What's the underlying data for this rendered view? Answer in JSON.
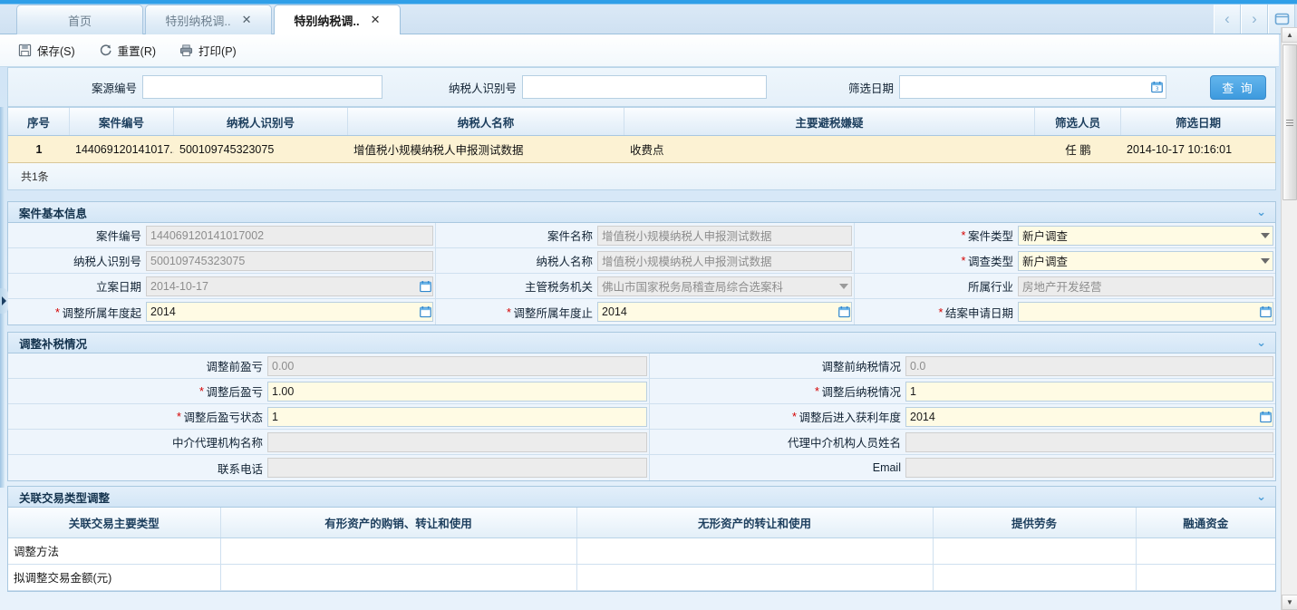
{
  "window": {
    "nav_prev": "‹",
    "nav_next": "›",
    "restore": "restore-window"
  },
  "tabs": [
    {
      "label": "首页",
      "active": false,
      "closable": false
    },
    {
      "label": "特别纳税调..",
      "active": false,
      "closable": true
    },
    {
      "label": "特别纳税调..",
      "active": true,
      "closable": true
    }
  ],
  "toolbar": {
    "save_label": "保存(S)",
    "reset_label": "重置(R)",
    "print_label": "打印(P)"
  },
  "search": {
    "case_source_no_label": "案源编号",
    "case_source_no_value": "",
    "taxpayer_id_label": "纳税人识别号",
    "taxpayer_id_value": "",
    "filter_date_label": "筛选日期",
    "filter_date_value": "",
    "query_button": "查 询"
  },
  "result_grid": {
    "columns": [
      "序号",
      "案件编号",
      "纳税人识别号",
      "纳税人名称",
      "主要避税嫌疑",
      "筛选人员",
      "筛选日期"
    ],
    "rows": [
      {
        "seq": "1",
        "case_no": "144069120141017...",
        "taxpayer_id": "500109745323075",
        "taxpayer_name": "增值税小规模纳税人申报测试数据",
        "tax_avoidance_suspicion": "收费点",
        "filter_person": "任  鹏",
        "filter_date": "2014-10-17 10:16:01"
      }
    ],
    "footer": "共1条"
  },
  "section_basic": {
    "title": "案件基本信息",
    "collapse_icon": "⌄",
    "fields": {
      "case_no_label": "案件编号",
      "case_no_value": "144069120141017002",
      "case_name_label": "案件名称",
      "case_name_value": "增值税小规模纳税人申报测试数据",
      "case_type_label": "案件类型",
      "case_type_value": "新户调查",
      "taxpayer_id_label": "纳税人识别号",
      "taxpayer_id_value": "500109745323075",
      "taxpayer_name_label": "纳税人名称",
      "taxpayer_name_value": "增值税小规模纳税人申报测试数据",
      "survey_type_label": "调查类型",
      "survey_type_value": "新户调查",
      "filing_date_label": "立案日期",
      "filing_date_value": "2014-10-17",
      "tax_authority_label": "主管税务机关",
      "tax_authority_value": "佛山市国家税务局稽查局综合选案科",
      "industry_label": "所属行业",
      "industry_value": "房地产开发经营",
      "adjust_year_from_label": "调整所属年度起",
      "adjust_year_from_value": "2014",
      "adjust_year_to_label": "调整所属年度止",
      "adjust_year_to_value": "2014",
      "close_apply_date_label": "结案申请日期",
      "close_apply_date_value": ""
    }
  },
  "section_adjust": {
    "title": "调整补税情况",
    "collapse_icon": "⌄",
    "fields": {
      "pre_profit_label": "调整前盈亏",
      "pre_profit_value": "0.00",
      "pre_tax_label": "调整前纳税情况",
      "pre_tax_value": "0.0",
      "post_profit_label": "调整后盈亏",
      "post_profit_value": "1.00",
      "post_tax_label": "调整后纳税情况",
      "post_tax_value": "1",
      "post_profit_state_label": "调整后盈亏状态",
      "post_profit_state_value": "1",
      "post_profit_year_label": "调整后进入获利年度",
      "post_profit_year_value": "2014",
      "agency_name_label": "中介代理机构名称",
      "agency_name_value": "",
      "agency_person_label": "代理中介机构人员姓名",
      "agency_person_value": "",
      "phone_label": "联系电话",
      "phone_value": "",
      "email_label": "Email",
      "email_value": ""
    }
  },
  "section_related": {
    "title": "关联交易类型调整",
    "collapse_icon": "⌄",
    "columns": [
      "关联交易主要类型",
      "有形资产的购销、转让和使用",
      "无形资产的转让和使用",
      "提供劳务",
      "融通资金"
    ],
    "rows": [
      {
        "label": "调整方法",
        "values": [
          "",
          "",
          "",
          ""
        ]
      },
      {
        "label": "拟调整交易金额(元)",
        "values": [
          "",
          "",
          "",
          ""
        ]
      }
    ]
  },
  "colors": {
    "accent": "#3d9ade",
    "selected_row": "#fcf2d3",
    "editable_field": "#fffbe4",
    "readonly_field": "#ececec",
    "required_star": "#d40000"
  }
}
